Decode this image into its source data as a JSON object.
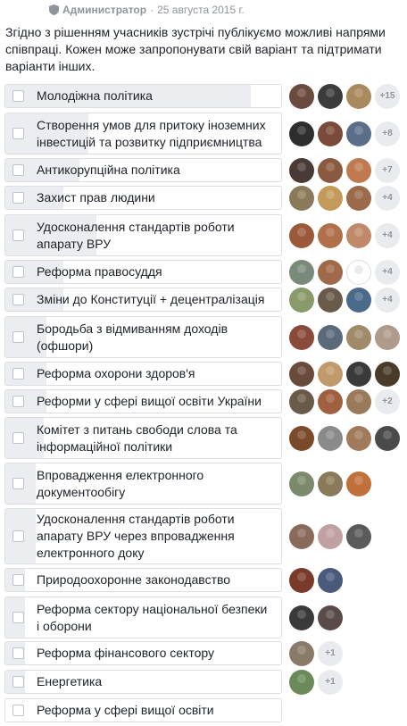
{
  "header": {
    "author": "Администратор",
    "separator": "·",
    "date": "25 августа 2015 г."
  },
  "intro": "Згідно з рішенням учасників зустрічі публікуємо можливі напрями співпраці. Кожен може запропонувати свій варіант та підтримати варіанти інших.",
  "colors": {
    "border": "#dddfe2",
    "bar_fill": "#ebedf0",
    "counter_bg": "#e9ebee",
    "muted_text": "#90949c"
  },
  "options": [
    {
      "label": "Молодіжна політика",
      "share": 0.89,
      "avatars": [
        "#6b4b3e",
        "#3b3b3b",
        "#a98a5e"
      ],
      "more": "+15"
    },
    {
      "label": "Створення умов для притоку іноземних інвестицій та розвитку підприємництва",
      "share": 0.3,
      "avatars": [
        "#2e2e2e",
        "#7a4a3a",
        "#5a6e8a"
      ],
      "more": "+8"
    },
    {
      "label": "Антикорупційна політика",
      "share": 0.27,
      "avatars": [
        "#4a3a35",
        "#8a5a40",
        "#c07a50"
      ],
      "more": "+7"
    },
    {
      "label": "Захист прав людини",
      "share": 0.21,
      "avatars": [
        "#8a7a5a",
        "#c49a5a",
        "#9a6a4a"
      ],
      "more": "+4"
    },
    {
      "label": "Удосконалення стандартів роботи апарату ВРУ",
      "share": 0.33,
      "avatars": [
        "#9a5a3a",
        "#b0704a",
        "#c08a6a"
      ],
      "more": "+4"
    },
    {
      "label": "Реформа правосуддя",
      "share": 0.21,
      "avatars": [
        "#7a8a7a",
        "#a06a4a",
        "blank"
      ],
      "more": "+4"
    },
    {
      "label": "Зміни до Конституції + децентралізація",
      "share": 0.21,
      "avatars": [
        "#8a9a6a",
        "#6a5a4a",
        "#4a6a8a"
      ],
      "more": "+4"
    },
    {
      "label": "Бородьба з відмиванням доходів (офшори)",
      "share": 0.15,
      "avatars": [
        "#8a4a3a",
        "#5a6a7a",
        "#a08a6a",
        "#b09a8a"
      ],
      "more": ""
    },
    {
      "label": "Реформа охорони здоров'я",
      "share": 0.15,
      "avatars": [
        "#6a4a3a",
        "#c09a6a",
        "#3a3a3a",
        "#4a3a2a"
      ],
      "more": ""
    },
    {
      "label": "Реформи у сфері вищої освіти України",
      "share": 0.15,
      "avatars": [
        "#6a5a4a",
        "#a06040",
        "#9a7a5a"
      ],
      "more": "+2"
    },
    {
      "label": "Комітет з питань свободи слова та інформаційної політики",
      "share": 0.14,
      "avatars": [
        "#7a4a2a",
        "#8a8a8a",
        "#a07a5a",
        "#4a4a4a"
      ],
      "more": ""
    },
    {
      "label": "Впровадження електронного документообігу",
      "share": 0.11,
      "avatars": [
        "#7a8a6a",
        "#8a7a5a",
        "#c0703a"
      ],
      "more": ""
    },
    {
      "label": "Удосконалення стандартів роботи апарату ВРУ через впровадження електронного доку",
      "share": 0.11,
      "avatars": [
        "#8a6a5a",
        "#c0a0a0",
        "#5a5a5a"
      ],
      "more": ""
    },
    {
      "label": "Природоохоронне законодавство",
      "share": 0.07,
      "avatars": [
        "#7a3a2a",
        "#4a5a7a"
      ],
      "more": ""
    },
    {
      "label": "Реформа сектору національної безпеки і оборони",
      "share": 0.07,
      "avatars": [
        "#3a3a3a",
        "#5a4a4a"
      ],
      "more": ""
    },
    {
      "label": "Реформа фінансового сектору",
      "share": 0.07,
      "avatars": [
        "#8a7a6a"
      ],
      "more": "+1"
    },
    {
      "label": "Енергетика",
      "share": 0.07,
      "avatars": [
        "#6a8a5a"
      ],
      "more": "+1"
    },
    {
      "label": "Реформа у сфері вищої освіти",
      "share": 0.0,
      "avatars": [],
      "more": ""
    }
  ]
}
